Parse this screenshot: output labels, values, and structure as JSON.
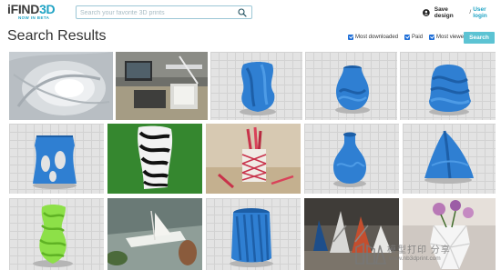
{
  "header": {
    "logo_main": "FIND",
    "logo_accent": "3D",
    "logo_prefix": "i",
    "logo_sub": "NOW IN BETA",
    "search_placeholder": "Search your favorite 3D prints",
    "save_design": "Save design",
    "separator": "/",
    "user_login": "User login"
  },
  "page": {
    "title": "Search Results"
  },
  "filters": [
    {
      "label": "Most downloaded",
      "checked": true
    },
    {
      "label": "Paid",
      "checked": true
    },
    {
      "label": "Most viewed",
      "checked": true
    }
  ],
  "search_button": "Search",
  "results": [
    {
      "name": "result-swirl-tunnel",
      "kind": "photo"
    },
    {
      "name": "result-3d-printer-desk",
      "kind": "photo"
    },
    {
      "name": "result-twisted-vase-blue",
      "kind": "render"
    },
    {
      "name": "result-round-vase-blue",
      "kind": "render"
    },
    {
      "name": "result-wave-vase-blue",
      "kind": "render"
    },
    {
      "name": "result-cutout-vase-blue",
      "kind": "render"
    },
    {
      "name": "result-zebra-vase",
      "kind": "photo"
    },
    {
      "name": "result-lattice-pencil-cup",
      "kind": "photo"
    },
    {
      "name": "result-bulb-vase-blue",
      "kind": "render"
    },
    {
      "name": "result-sail-vase-blue",
      "kind": "render"
    },
    {
      "name": "result-green-vase",
      "kind": "photo"
    },
    {
      "name": "result-boat-model",
      "kind": "photo"
    },
    {
      "name": "result-spiral-vase-blue",
      "kind": "render"
    },
    {
      "name": "result-spiral-vase-set",
      "kind": "photo"
    },
    {
      "name": "result-faceted-vase-flowers",
      "kind": "photo"
    }
  ],
  "watermark": {
    "text": "模型打印 分享",
    "url": "www.nb3dprint.com"
  },
  "colors": {
    "accent": "#1fa3c4",
    "print_blue": "#2f7fd2",
    "checkbox": "#1f6fd8",
    "button": "#5cc3d3"
  }
}
